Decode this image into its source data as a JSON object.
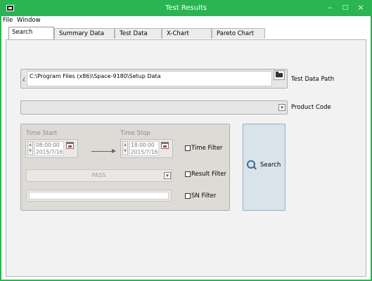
{
  "window": {
    "title": "Test Results",
    "controls": {
      "minimize": "–",
      "maximize": "□",
      "close": "×"
    }
  },
  "menu": {
    "items": [
      "File",
      "Window"
    ]
  },
  "tabs": [
    "Search",
    "Summary Data",
    "Test Data",
    "X-Chart",
    "Pareto Chart"
  ],
  "active_tab": "Search",
  "test_data_path": {
    "value": "C:\\Program Files (x86)\\Space-9180\\Setup Data",
    "label": "Test Data Path",
    "cursor": "¿"
  },
  "product_code": {
    "label": "Product Code",
    "value": ""
  },
  "filter": {
    "time_start_label": "Time Start",
    "time_start_value": "08:00:00",
    "time_start_date": "2015/7/16",
    "time_stop_label": "Time Stop",
    "time_stop_value": "18:00:00",
    "time_stop_date": "2015/7/16",
    "time_filter_label": "Time Filter",
    "result_value": "PASS",
    "result_filter_label": "Result Filter",
    "sn_value": "",
    "sn_filter_label": "SN Filter",
    "spin_up": "▲",
    "spin_down": "▼",
    "dropdown_arrow": "▾"
  },
  "search_button": {
    "label": "Search",
    "icon": "magnifier-icon"
  },
  "colors": {
    "titlebar": "#2bb552",
    "search_button": "#d8e3ea"
  }
}
